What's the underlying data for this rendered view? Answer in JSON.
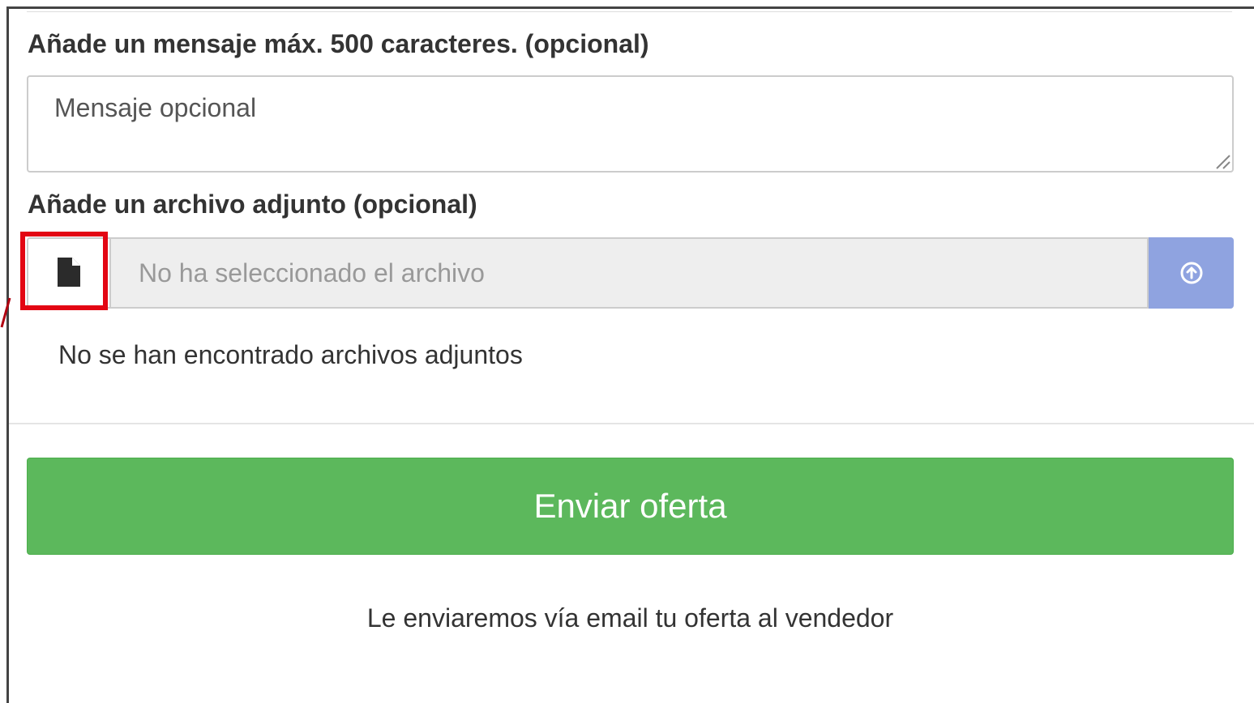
{
  "message": {
    "label": "Añade un mensaje máx. 500 caracteres. (opcional)",
    "placeholder": "Mensaje opcional",
    "value": ""
  },
  "attachment": {
    "label": "Añade un archivo adjunto (opcional)",
    "file_icon": "file-icon",
    "file_display_text": "No ha seleccionado el archivo",
    "upload_icon": "upload-circle-arrow-icon",
    "empty_state": "No se han encontrado archivos adjuntos"
  },
  "actions": {
    "submit_label": "Enviar oferta",
    "note": "Le enviaremos vía email tu oferta al vendedor"
  },
  "colors": {
    "submit_green": "#5cb85c",
    "upload_blue": "#8fa3e0",
    "highlight_red": "#e30613",
    "input_gray": "#eeeeee"
  }
}
